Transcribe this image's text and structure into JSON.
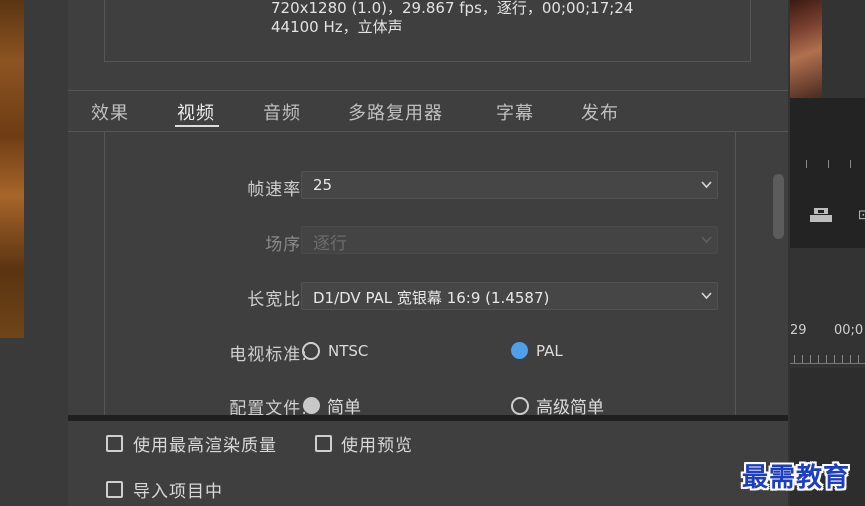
{
  "summary": {
    "video_line": "720x1280 (1.0)，29.867 fps，逐行，00;00;17;24",
    "audio_line": "44100 Hz，立体声"
  },
  "tabs": [
    {
      "label": "效果",
      "active": false
    },
    {
      "label": "视频",
      "active": true
    },
    {
      "label": "音频",
      "active": false
    },
    {
      "label": "多路复用器",
      "active": false
    },
    {
      "label": "字幕",
      "active": false
    },
    {
      "label": "发布",
      "active": false
    }
  ],
  "video": {
    "frame_rate": {
      "label": "帧速率:",
      "value": "25"
    },
    "field_order": {
      "label": "场序:",
      "value": "逐行",
      "enabled": false
    },
    "aspect": {
      "label": "长宽比:",
      "value": "D1/DV PAL 宽银幕 16:9 (1.4587)"
    },
    "tv_standard": {
      "label": "电视标准:",
      "options": [
        "NTSC",
        "PAL"
      ],
      "selected": "PAL"
    },
    "profile": {
      "label": "配置文件:",
      "options": [
        "简单",
        "高级简单"
      ],
      "selected": "简单"
    }
  },
  "bottom": {
    "max_quality_label": "使用最高渲染质量",
    "preview_label": "使用预览",
    "import_label": "导入项目中"
  },
  "timeline": {
    "label_a": "29",
    "label_b": "00;0"
  },
  "watermark": "最需教育",
  "colors": {
    "accent_radio": "#4f9fea",
    "panel_bg": "#3f3f3f",
    "watermark": "#1d3fbf"
  }
}
